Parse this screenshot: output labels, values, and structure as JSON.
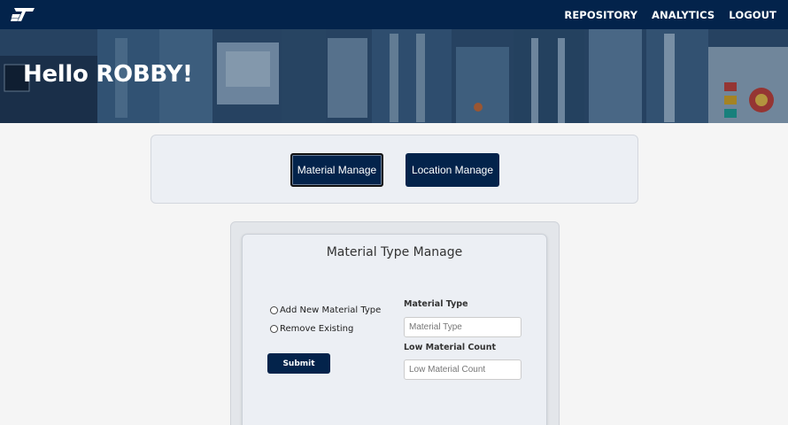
{
  "navbar": {
    "logo_icon": "st-logo-icon",
    "links": [
      "REPOSITORY",
      "ANALYTICS",
      "LOGOUT"
    ],
    "background": "#03234b"
  },
  "hero": {
    "greeting": "Hello ROBBY!"
  },
  "tabs": {
    "material_label": "Material Manage",
    "location_label": "Location Manage",
    "active": "Material Manage"
  },
  "form": {
    "title": "Material Type Manage",
    "options": [
      {
        "label": "Add New Material Type",
        "checked": false
      },
      {
        "label": "Remove Existing",
        "checked": false
      }
    ],
    "submit_label": "Submit",
    "material_type": {
      "label": "Material Type",
      "placeholder": "Material Type",
      "value": ""
    },
    "low_count": {
      "label": "Low Material Count",
      "placeholder": "Low Material Count",
      "value": ""
    }
  }
}
